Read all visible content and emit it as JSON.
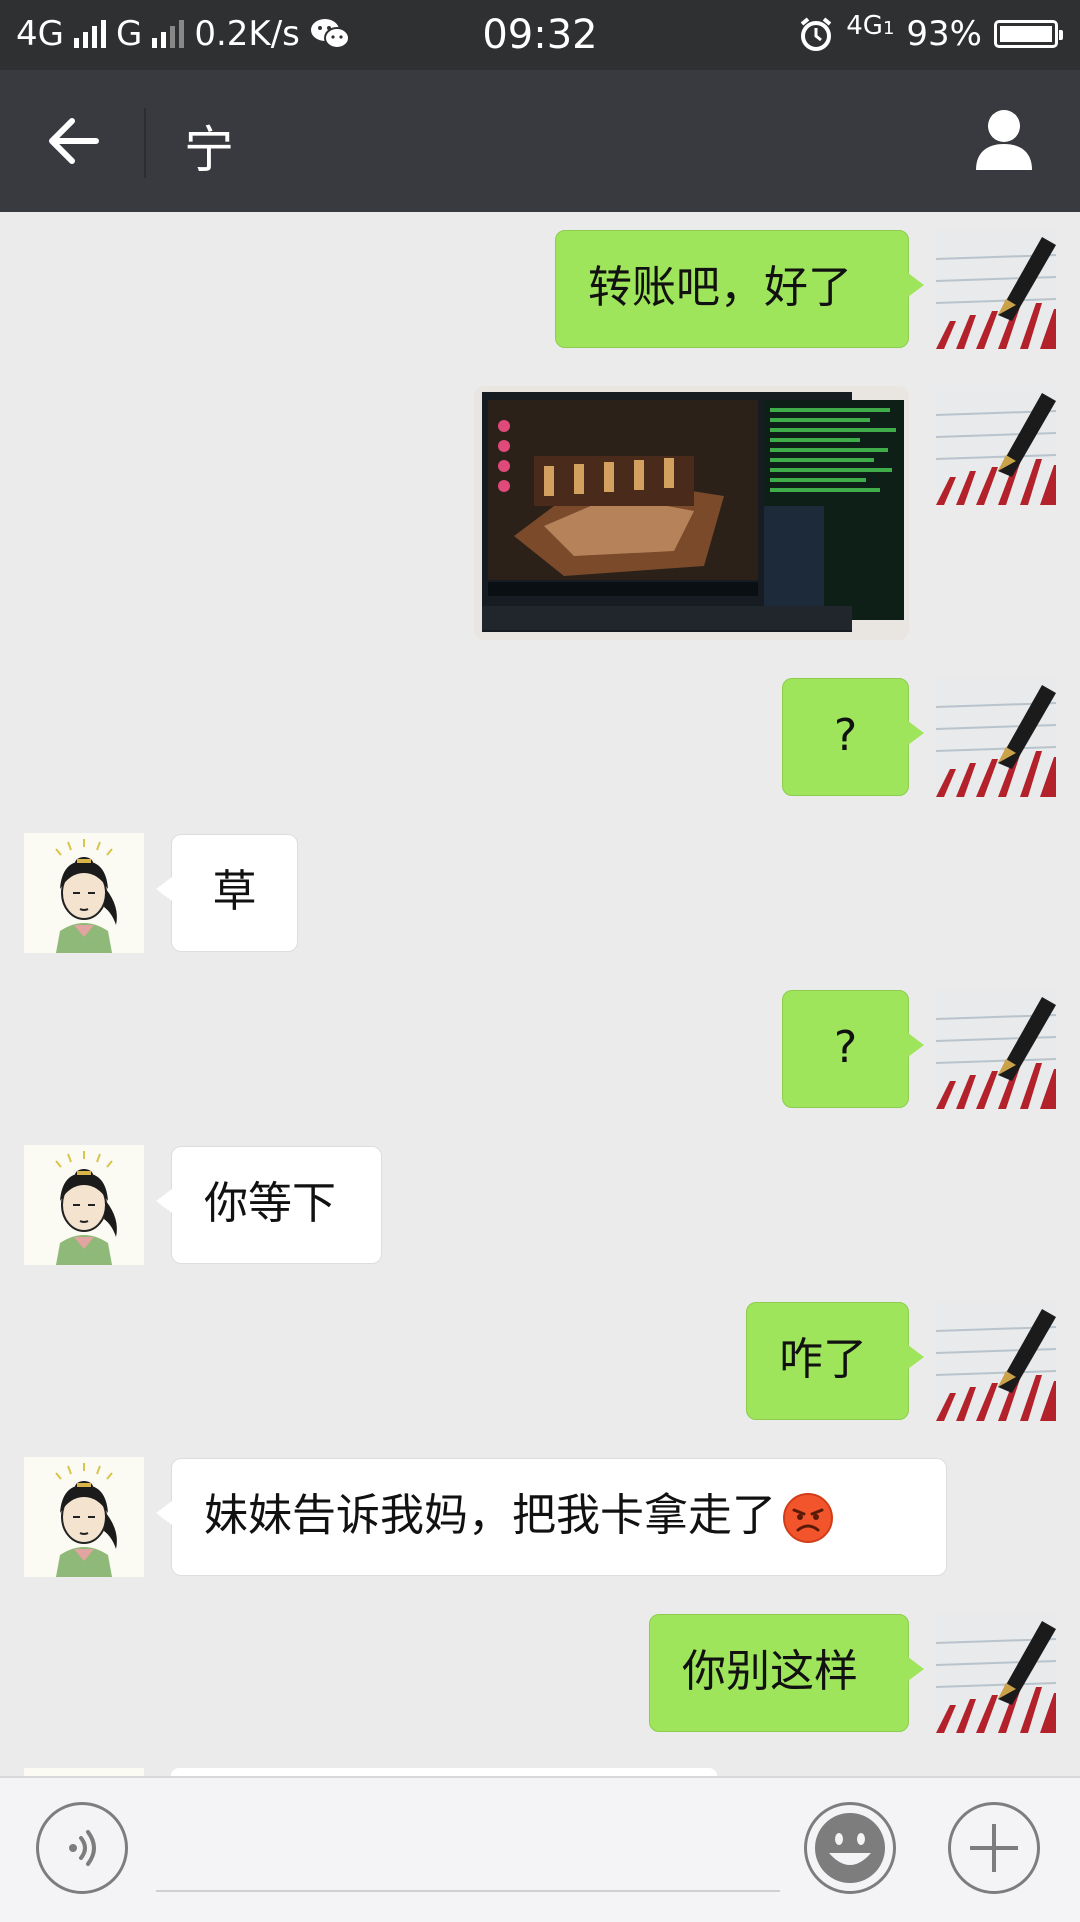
{
  "status_bar": {
    "network_1": "4G",
    "network_2": "G",
    "speed": "0.2K/s",
    "time": "09:32",
    "network_3": "4G",
    "network_3_sub": "1",
    "battery": "93%"
  },
  "header": {
    "title": "宁"
  },
  "messages": [
    {
      "side": "out",
      "type": "text",
      "text": "转账吧，好了"
    },
    {
      "side": "out",
      "type": "image"
    },
    {
      "side": "out",
      "type": "text",
      "text": "?"
    },
    {
      "side": "in",
      "type": "text",
      "text": "草"
    },
    {
      "side": "out",
      "type": "text",
      "text": "?"
    },
    {
      "side": "in",
      "type": "text",
      "text": "你等下"
    },
    {
      "side": "out",
      "type": "text",
      "text": "咋了"
    },
    {
      "side": "in",
      "type": "text",
      "text": "妹妹告诉我妈，把我卡拿走了",
      "emoji": "angry-face"
    },
    {
      "side": "out",
      "type": "text",
      "text": "你别这样"
    }
  ],
  "colors": {
    "status_bar": "#2f3032",
    "title_bar": "#393a3f",
    "chat_bg": "#ebebeb",
    "outgoing_bubble": "#9fe55b",
    "incoming_bubble": "#ffffff"
  }
}
